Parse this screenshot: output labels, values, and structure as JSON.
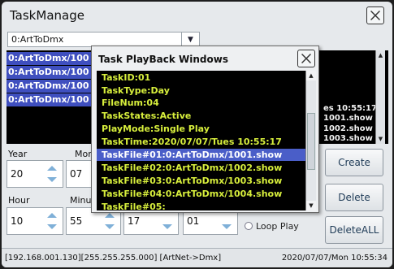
{
  "window": {
    "title": "TaskManage"
  },
  "task_select": {
    "value": "0:ArtToDmx"
  },
  "task_list": {
    "items": [
      "0:ArtToDmx/100",
      "0:ArtToDmx/100",
      "0:ArtToDmx/100",
      "0:ArtToDmx/100"
    ],
    "right_col": [
      "es 10:55:17",
      "1001.show",
      "1002.show",
      "1003.show"
    ]
  },
  "fields": {
    "year_label": "Year",
    "year_value": "20",
    "month_label": "Mor",
    "month_value": "07",
    "hour_label": "Hour",
    "hour_value": "10",
    "minute_label": "Minu",
    "minute_value": "55",
    "second_value": "17",
    "extra_value": "01",
    "loop_label": "Loop Play"
  },
  "buttons": {
    "create": "Create",
    "delete": "Delete",
    "delete_all": "DeleteALL"
  },
  "status": {
    "left": "[192.168.001.130][255.255.255.000] [ArtNet->Dmx]",
    "right": "2020/07/07/Mon 10:55:34"
  },
  "dialog": {
    "title": "Task PlayBack Windows",
    "lines": [
      "TaskID:01",
      "TaskType:Day",
      "FileNum:04",
      "TaskStates:Active",
      "PlayMode:Single Play",
      "TaskTime:2020/07/07/Tues 10:55:17",
      "TaskFile#01:0:ArtToDmx/1001.show",
      "TaskFile#02:0:ArtToDmx/1002.show",
      "TaskFile#03:0:ArtToDmx/1003.show",
      "TaskFile#04:0:ArtToDmx/1004.show",
      "TaskFile#05:"
    ],
    "selected_line": "TaskFile#01:0:ArtToDmx/1001.show"
  },
  "colors": {
    "selection": "#4a5ec8",
    "dialog_text": "#d7ee3c",
    "list_bg": "#000000"
  }
}
